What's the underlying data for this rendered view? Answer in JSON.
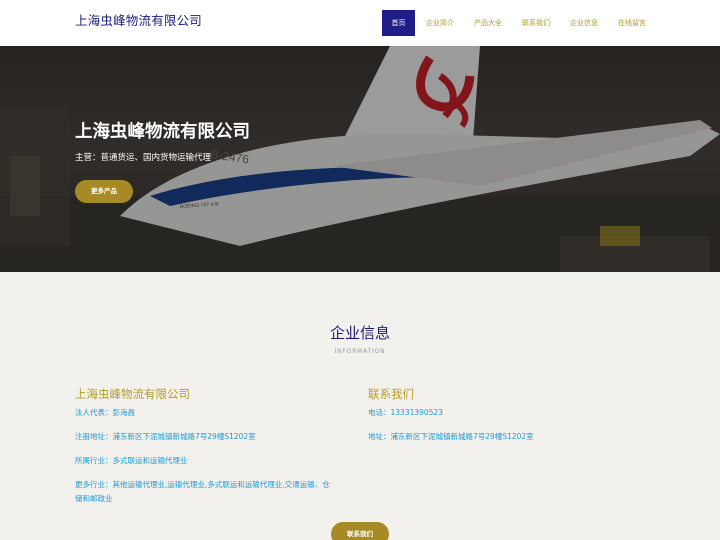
{
  "header": {
    "brand": "上海虫峰物流有限公司",
    "nav": [
      "首页",
      "企业简介",
      "产品大全",
      "联系我们",
      "企业信息",
      "在线留言"
    ]
  },
  "hero": {
    "title": "上海虫峰物流有限公司",
    "subtitle": "主营：普通货运、国内货物运输代理",
    "button": "更多产品",
    "plane_registration": "B-2476",
    "plane_model": "BOEING 747-4J6"
  },
  "info": {
    "title": "企业信息",
    "subtitle": "INFORMATION",
    "company": {
      "name": "上海虫峰物流有限公司",
      "legal_rep": "法人代表：彭海昌",
      "address": "注册地址：浦东新区下泥城镇新城路7号29幢S1202室",
      "industry": "所属行业：多式联运和运输代理业",
      "more_industry_1": "更多行业：其他运输代理业,运输代理业,多式联运和运输代理业,交通运输、仓",
      "more_industry_2": "储和邮政业"
    },
    "contact": {
      "title": "联系我们",
      "phone": "电话：13331390523",
      "address": "地址：浦东新区下泥城镇新城路7号29幢S1202室"
    },
    "contact_button": "联系我们"
  }
}
